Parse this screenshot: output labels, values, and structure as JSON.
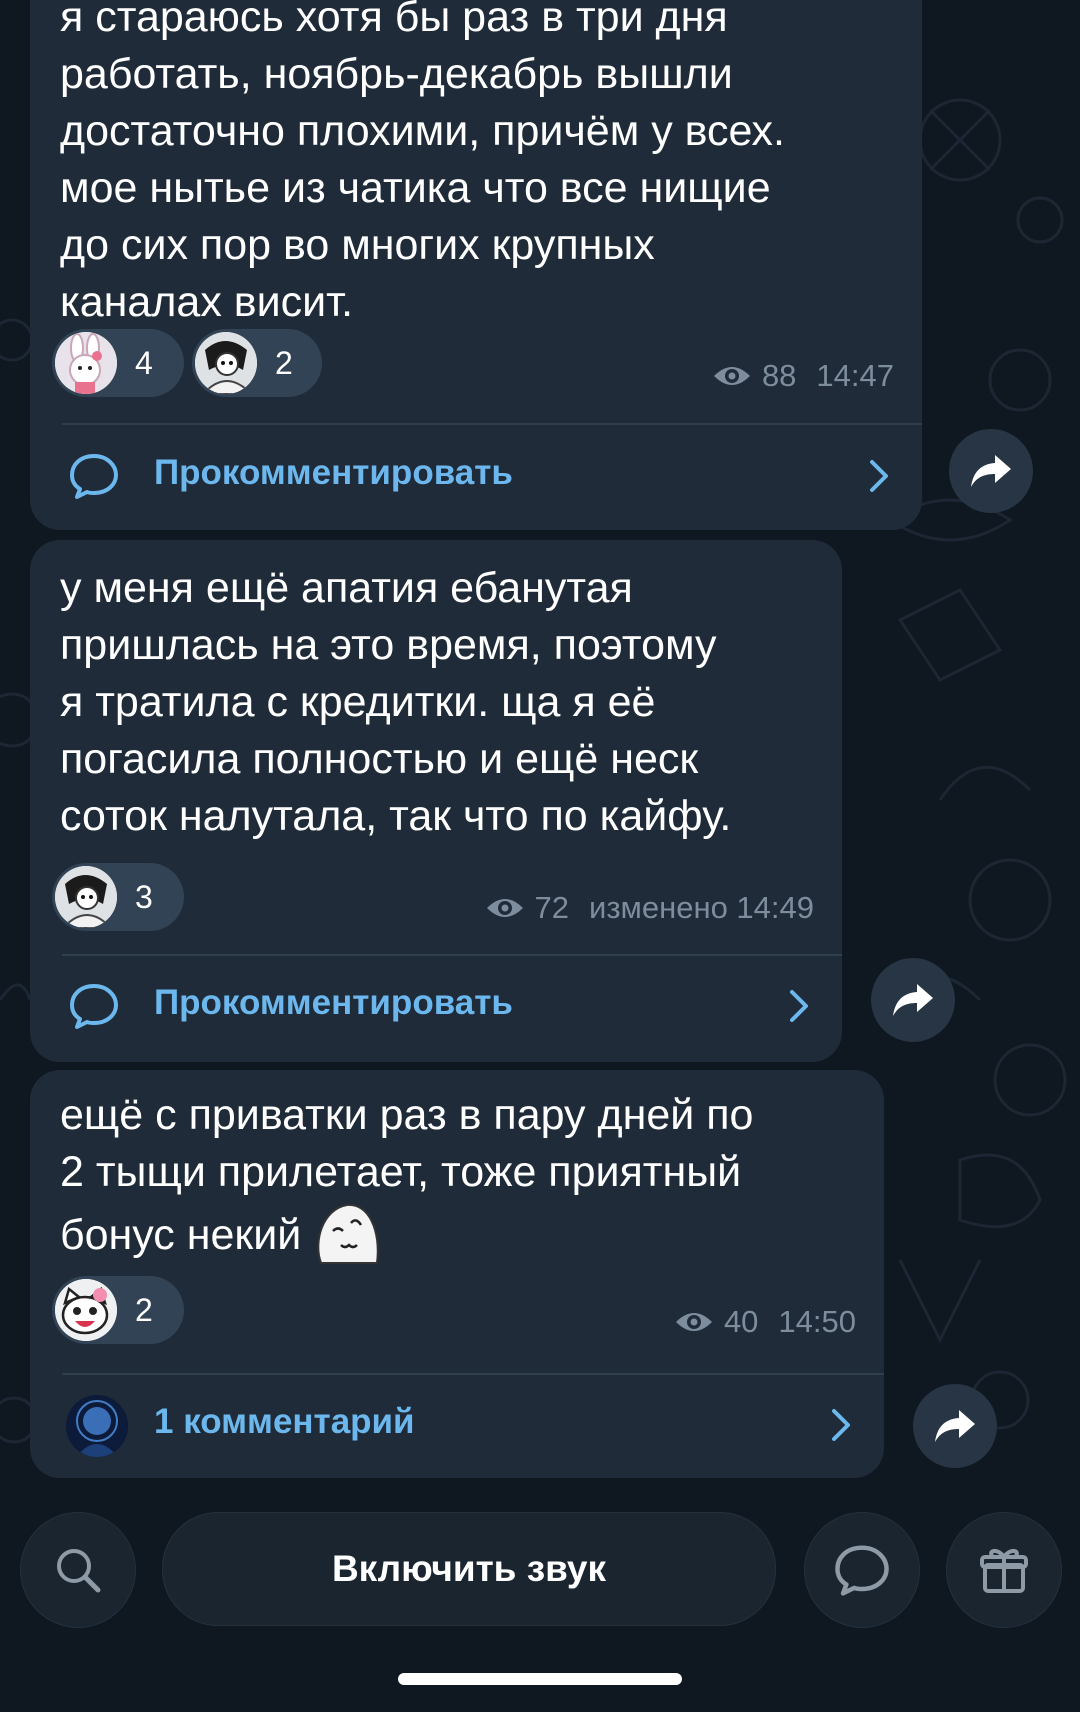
{
  "messages": [
    {
      "text": "я стараюсь хотя бы раз в три дня\nработать, ноябрь-декабрь вышли\nдостаточно плохими, причём у всех.\nмое нытье из чатика что все нищие\nдо сих пор во многих крупных\nканалах висит.",
      "reactions": [
        {
          "icon": "bunny-sticker-icon",
          "count": "4"
        },
        {
          "icon": "anime-girl-sticker-icon",
          "count": "2"
        }
      ],
      "views": "88",
      "time": "14:47",
      "comment_label": "Прокомментировать"
    },
    {
      "text": "у меня ещё апатия ебанутая\nпришлась на это время, поэтому\nя тратила с кредитки. ща я её\nпогасила полностью и ещё неск\nсоток налутала, так что по кайфу.",
      "reactions": [
        {
          "icon": "anime-girl-sticker-icon",
          "count": "3"
        }
      ],
      "views": "72",
      "time": "изменено 14:49",
      "comment_label": "Прокомментировать"
    },
    {
      "text": "ещё с приватки раз в пару дней по\n2 тыщи прилетает, тоже приятный\nбонус некий",
      "emoji_icon": "smiling-blob-emoji-icon",
      "reactions": [
        {
          "icon": "hello-kitty-sticker-icon",
          "count": "2"
        }
      ],
      "views": "40",
      "time": "14:50",
      "comment_label": "1 комментарий"
    }
  ],
  "bottom_bar": {
    "unmute_label": "Включить звук",
    "search_icon": "search-icon",
    "comments_icon": "chat-bubble-icon",
    "gift_icon": "gift-icon"
  },
  "colors": {
    "background": "#0f1721",
    "bubble": "#1f2b38",
    "link": "#6cb8ee",
    "meta": "#7d8d9d"
  }
}
